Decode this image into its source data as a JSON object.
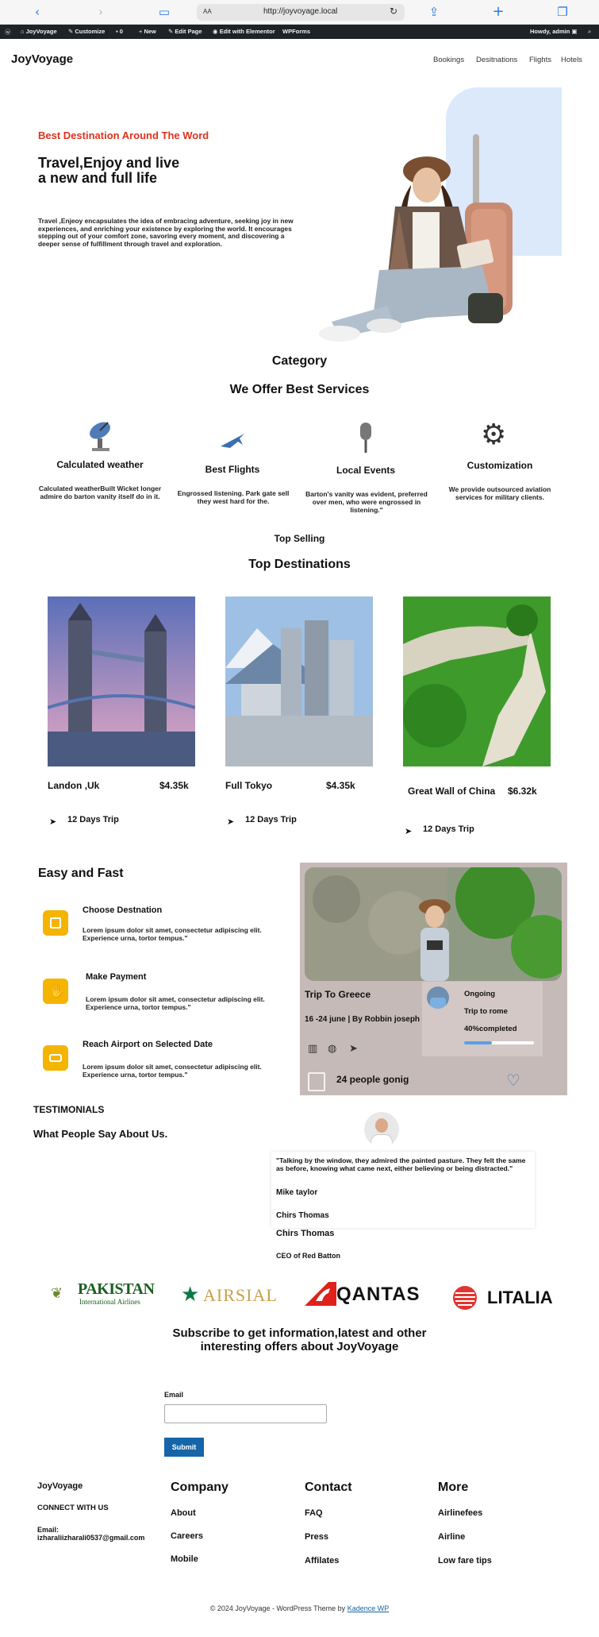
{
  "browser": {
    "url": "http://joyvoyage.local",
    "text_size": "AA"
  },
  "admin_bar": {
    "site": "JoyVoyage",
    "customize": "Customize",
    "comments": "0",
    "new": "New",
    "edit_page": "Edit Page",
    "elementor": "Edit with Elementor",
    "wpforms": "WPForms",
    "howdy": "Howdy, admin"
  },
  "header": {
    "logo": "JoyVoyage",
    "nav": [
      "Bookings",
      "Desitnations",
      "Flights",
      "Hotels"
    ]
  },
  "hero": {
    "tag": "Best Destination Around The Word",
    "title": "Travel,Enjoy and live a new and full life",
    "text": "Travel ,Enjeoy encapsulates the idea of embracing adventure, seeking joy in new experiences, and enriching your existence by exploring the world. It encourages stepping out of your comfort zone, savoring every moment, and discovering a deeper sense of fulfillment through travel and exploration."
  },
  "services": {
    "eyebrow": "Category",
    "title": "We Offer Best Services",
    "items": [
      {
        "title": "Calculated weather",
        "text": "Calculated weatherBuilt Wicket longer admire do barton vanity itself do in  it.",
        "icon": "satellite-dish-icon"
      },
      {
        "title": "Best Flights",
        "text": "Engrossed listening. Park gate sell they west hard for the.",
        "icon": "airplane-icon"
      },
      {
        "title": "Local Events",
        "text": "Barton's vanity was evident, preferred over men, who were engrossed in listening.\"",
        "icon": "microphone-icon"
      },
      {
        "title": "Customization",
        "text": "We provide outsourced aviation services for military clients.",
        "icon": "gear-icon"
      }
    ]
  },
  "destinations": {
    "eyebrow": "Top Selling",
    "title": "Top Destinations",
    "items": [
      {
        "name": "Landon ,Uk",
        "price": "$4.35k",
        "trip": "12 Days Trip"
      },
      {
        "name": "Full Tokyo",
        "price": "$4.35k",
        "trip": "12 Days Trip"
      },
      {
        "name": "Great Wall of China",
        "price": "$6.32k",
        "trip": "12 Days Trip"
      }
    ]
  },
  "steps": {
    "title": "Easy and Fast",
    "items": [
      {
        "title": "Choose Destnation",
        "text": "Lorem ipsum dolor sit amet, consectetur adipiscing elit. Experience urna, tortor tempus.\""
      },
      {
        "title": "Make Payment",
        "text": "Lorem ipsum dolor sit amet, consectetur adipiscing elit. Experience urna, tortor tempus.\""
      },
      {
        "title": "Reach Airport on Selected Date",
        "text": "Lorem ipsum dolor sit amet, consectetur adipiscing elit. Experience urna, tortor tempus.\""
      }
    ]
  },
  "trip_card": {
    "title": "Trip To Greece",
    "meta": "16 -24 june | By Robbin joseph",
    "people": "24 people gonig",
    "status": "Ongoing",
    "subtitle": "Trip to rome",
    "progress_label": "40%completed",
    "progress": 0.4
  },
  "testimonials": {
    "eyebrow": "TESTIMONIALS",
    "title": "What People Say About Us.",
    "quote": "\"Talking by the window, they admired the painted pasture. They felt the same as before, knowing what came next, either believing or being distracted.\"",
    "author": "Mike taylor",
    "name1": "Chirs Thomas",
    "name2": "Chirs Thomas",
    "role": "CEO of Red Batton"
  },
  "partners": {
    "pakistan_1": "PAKISTAN",
    "pakistan_2": "International Airlines",
    "airsial": "AIRSIAL",
    "qantas": "QANTAS",
    "litalia": "LITALIA"
  },
  "subscribe": {
    "title": "Subscribe to get information,latest and other interesting offers about JoyVoyage",
    "email_label": "Email",
    "email_value": "",
    "button": "Submit"
  },
  "footer": {
    "brand": "JoyVoyage",
    "connect": "CONNECT WITH US",
    "email": "Email: izharaliizharali0537@gmail.com",
    "company": {
      "title": "Company",
      "links": [
        "About",
        "Careers",
        "Mobile"
      ]
    },
    "contact": {
      "title": "Contact",
      "links": [
        "FAQ",
        "Press",
        "Affilates"
      ]
    },
    "more": {
      "title": "More",
      "links": [
        "Airlinefees",
        "Airline",
        "Low fare tips"
      ]
    },
    "copyright": "© 2024 JoyVoyage - WordPress Theme by",
    "credit": "Kadence WP"
  },
  "colors": {
    "accent": "#e0321e",
    "icon_yellow": "#f4b400",
    "submit": "#1565a8",
    "admin": "#1d2327"
  }
}
